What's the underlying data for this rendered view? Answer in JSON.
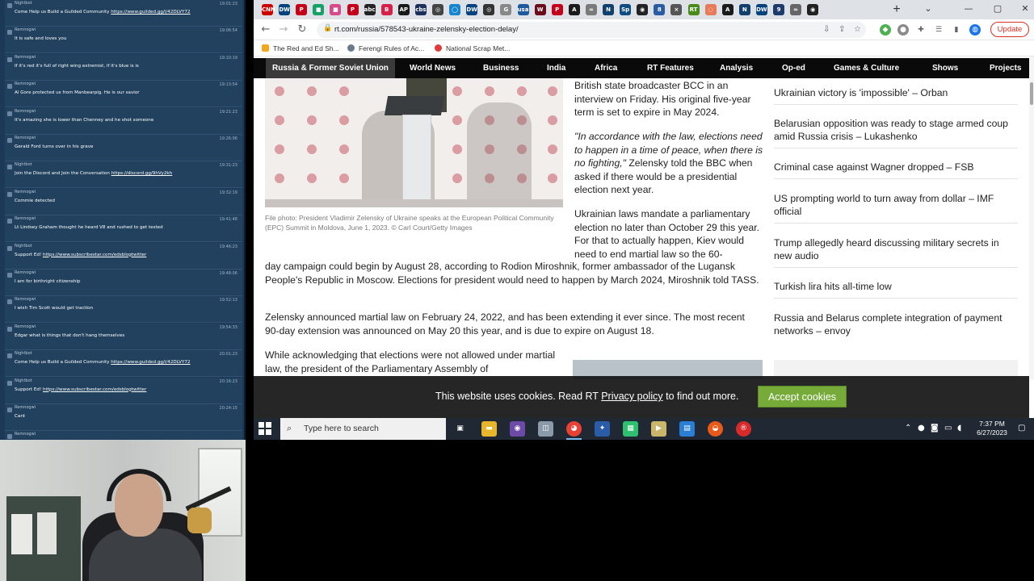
{
  "chat": {
    "messages": [
      {
        "user": "Nightbot",
        "time": "19:01:23",
        "text": "Come Help us Build a Guilded Community ",
        "link": "https://www.guilded.gg/i/42DLVY72"
      },
      {
        "user": "Remnogwi",
        "time": "19:06:54",
        "text": "It is safe and loves you",
        "link": ""
      },
      {
        "user": "Remnogwi",
        "time": "19:10:19",
        "text": "If it's red it's full of right wing extremist, if it's blue is is",
        "link": ""
      },
      {
        "user": "Remnogwi",
        "time": "19:13:54",
        "text": "Al Gore protected us from Manbearpig. He is our savior",
        "link": ""
      },
      {
        "user": "Remnogwi",
        "time": "19:21:23",
        "text": "It's amazing she is lower than Chenney and he shot someone",
        "link": ""
      },
      {
        "user": "Remnogwi",
        "time": "19:26:06",
        "text": "Gerald Ford turns over in his grave",
        "link": ""
      },
      {
        "user": "Nightbot",
        "time": "19:31:23",
        "text": "Join the Discord and Join the Conversation ",
        "link": "https://discord.gg/9hVy2kh"
      },
      {
        "user": "Remnogwi",
        "time": "19:32:19",
        "text": "Commie detected",
        "link": ""
      },
      {
        "user": "Remnogwi",
        "time": "19:41:48",
        "text": "Lt Lindsey Graham thought he heard V8 and rushed to get tested",
        "link": ""
      },
      {
        "user": "Nightbot",
        "time": "19:46:23",
        "text": "Support Ed! ",
        "link": "https://www.subscribestar.com/edsblogtwitter"
      },
      {
        "user": "Remnogwi",
        "time": "19:48:06",
        "text": "I am for birthright citizenship",
        "link": ""
      },
      {
        "user": "Remnogwi",
        "time": "19:52:13",
        "text": "I wish Tim Scott would get traction",
        "link": ""
      },
      {
        "user": "Remnogwi",
        "time": "19:54:33",
        "text": "Edgar what is things that don't hang themselves",
        "link": ""
      },
      {
        "user": "Nightbot",
        "time": "20:01:23",
        "text": "Come Help us Build a Guilded Community ",
        "link": "https://www.guilded.gg/i/42DLVY72"
      },
      {
        "user": "Nightbot",
        "time": "20:16:23",
        "text": "Support Ed! ",
        "link": "https://www.subscribestar.com/edsblogtwitter"
      },
      {
        "user": "Remnogwi",
        "time": "20:24:15",
        "text": "Cant",
        "link": ""
      },
      {
        "user": "Remnogwi",
        "time": "",
        "text": "",
        "link": ""
      }
    ]
  },
  "browser": {
    "url": "rt.com/russia/578543-ukraine-zelensky-election-delay/",
    "update_label": "Update",
    "bookmarks": [
      "The Red and Ed Sh...",
      "Ferengi Rules of Ac...",
      "National Scrap Met..."
    ],
    "tab_icons": [
      {
        "label": "CNN",
        "color": "#cc0000"
      },
      {
        "label": "DW",
        "color": "#05437e"
      },
      {
        "label": "P",
        "color": "#c4001a"
      },
      {
        "label": "■",
        "color": "#18a06b"
      },
      {
        "label": "■",
        "color": "#d84a8c"
      },
      {
        "label": "P",
        "color": "#c4001a"
      },
      {
        "label": "abc",
        "color": "#222222"
      },
      {
        "label": "B",
        "color": "#d6204a"
      },
      {
        "label": "AP",
        "color": "#1a1a1a"
      },
      {
        "label": "cbs",
        "color": "#1c2f5a"
      },
      {
        "label": "◎",
        "color": "#444444"
      },
      {
        "label": "◯",
        "color": "#1585d0"
      },
      {
        "label": "DW",
        "color": "#05437e"
      },
      {
        "label": "◎",
        "color": "#333333"
      },
      {
        "label": "G",
        "color": "#888888"
      },
      {
        "label": "usa",
        "color": "#1d5a9e"
      },
      {
        "label": "W",
        "color": "#6a0d1a"
      },
      {
        "label": "P",
        "color": "#c4001a"
      },
      {
        "label": "A",
        "color": "#1a1a1a"
      },
      {
        "label": "≈",
        "color": "#7a7a7a"
      },
      {
        "label": "N",
        "color": "#12406c"
      },
      {
        "label": "Sp",
        "color": "#0f4c81"
      },
      {
        "label": "◉",
        "color": "#222222"
      },
      {
        "label": "8",
        "color": "#2b5ba0"
      },
      {
        "label": "×",
        "color": "#555555"
      },
      {
        "label": "RT",
        "color": "#4a8a1a"
      },
      {
        "label": "◌",
        "color": "#e87a5a"
      },
      {
        "label": "A",
        "color": "#1a1a1a"
      },
      {
        "label": "N",
        "color": "#12406c"
      },
      {
        "label": "DW",
        "color": "#05437e"
      },
      {
        "label": "9",
        "color": "#1d3c6e"
      },
      {
        "label": "≈",
        "color": "#666666"
      },
      {
        "label": "◉",
        "color": "#222222"
      }
    ]
  },
  "page": {
    "nav": [
      "Russia & Former Soviet Union",
      "World News",
      "Business",
      "India",
      "Africa",
      "RT Features",
      "Analysis",
      "Op-ed",
      "Games & Culture",
      "Shows",
      "Projects"
    ],
    "caption": "File photo: President Vladimir Zelensky of Ukraine speaks at the European Political Community (EPC) Summit in Moldova, June 1, 2023. © Carl Court/Getty Images",
    "p1": "British state broadcaster BCC in an interview on Friday. His original five-year term is set to expire in May 2024.",
    "p2_quote": "\"In accordance with the law, elections need to happen in a time of peace, when there is no fighting,\"",
    "p2_rest": " Zelensky told the BBC when asked if there would be a presidential election next year.",
    "p3a": "Ukrainian laws mandate a parliamentary election no later than October 29 this year. For that to actually happen, Kiev would need to end martial law so the 60-",
    "p3b": "day campaign could begin by August 28, according to Rodion Miroshnik, former ambassador of the Lugansk People's Republic in Moscow. Elections for president would need to happen by March 2024, Miroshnik told TASS.",
    "p4": "Zelensky announced martial law on February 24, 2022, and has been extending it ever since. The most recent 90-day extension was announced on May 20 this year, and is due to expire on August 18.",
    "p5": "While acknowledging that elections were not allowed under martial law, the president of the  Parliamentary Assembly of",
    "side_news": [
      "Ukrainian victory is 'impossible' – Orban",
      "Belarusian opposition was ready to stage armed coup amid Russia crisis – Lukashenko",
      "Criminal case against Wagner dropped – FSB",
      "US prompting world to turn away from dollar – IMF official",
      "Trump allegedly heard discussing military secrets in new audio",
      "Turkish lira hits all-time low",
      "Russia and Belarus complete integration of payment networks – envoy"
    ],
    "cookie_before": "This website uses cookies. Read RT ",
    "cookie_link": "Privacy policy",
    "cookie_after": " to find out more.",
    "cookie_accept": "Accept cookies"
  },
  "taskbar": {
    "search_placeholder": "Type here to search",
    "time": "7:37 PM",
    "date": "6/27/2023"
  }
}
